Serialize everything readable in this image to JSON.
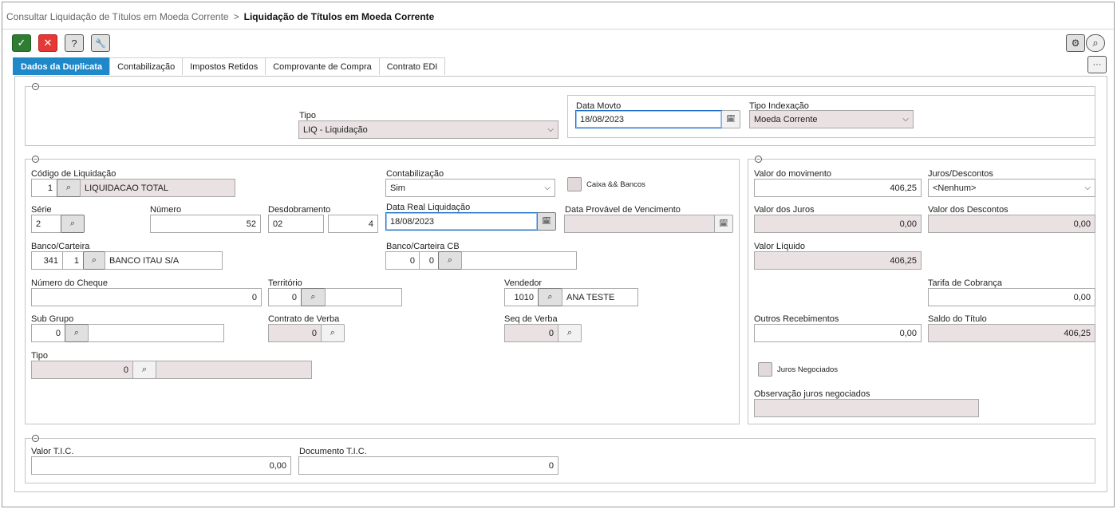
{
  "breadcrumb": {
    "parent": "Consultar Liquidação de Títulos em Moeda Corrente",
    "separator": ">",
    "current": "Liquidação de Títulos em Moeda Corrente"
  },
  "toolbar": {
    "confirm": "✓",
    "cancel": "✕",
    "help": "?",
    "tools": "🔧",
    "settings": "⚙",
    "search": "⌕",
    "more": "···"
  },
  "tabs": [
    "Dados da Duplicata",
    "Contabilização",
    "Impostos Retidos",
    "Comprovante de Compra",
    "Contrato EDI"
  ],
  "icons": {
    "collapse": "−",
    "lookup": "⌕",
    "calendar": "🗓",
    "chevron": "⌵"
  },
  "top": {
    "tipo_label": "Tipo",
    "tipo_value": "LIQ - Liquidação",
    "data_movto_label": "Data Movto",
    "data_movto_value": "18/08/2023",
    "tipo_indexacao_label": "Tipo Indexação",
    "tipo_indexacao_value": "Moeda Corrente"
  },
  "main": {
    "cod_liq_label": "Código de Liquidação",
    "cod_liq_value": "1",
    "cod_liq_desc": "LIQUIDACAO TOTAL",
    "contab_label": "Contabilização",
    "contab_value": "Sim",
    "caixa_label": "Caixa && Bancos",
    "serie_label": "Série",
    "serie_value": "2",
    "numero_label": "Número",
    "numero_value": "52",
    "desdob_label": "Desdobramento",
    "desdob_value1": "02",
    "desdob_value2": "4",
    "data_real_label": "Data Real Liquidação",
    "data_real_value": "18/08/2023",
    "data_prov_label": "Data Provável de Vencimento",
    "banco_label": "Banco/Carteira",
    "banco_value1": "341",
    "banco_value2": "1",
    "banco_desc": "BANCO ITAU S/A",
    "banco_cb_label": "Banco/Carteira CB",
    "banco_cb_value1": "0",
    "banco_cb_value2": "0",
    "cheque_label": "Número do Cheque",
    "cheque_value": "0",
    "territorio_label": "Território",
    "territorio_value": "0",
    "vendedor_label": "Vendedor",
    "vendedor_value": "1010",
    "vendedor_desc": "ANA TESTE",
    "subgrupo_label": "Sub Grupo",
    "subgrupo_value": "0",
    "contrato_label": "Contrato de Verba",
    "contrato_value": "0",
    "seq_label": "Seq de Verba",
    "seq_value": "0",
    "tipo2_label": "Tipo",
    "tipo2_value": "0"
  },
  "right": {
    "valor_mov_label": "Valor do movimento",
    "valor_mov_value": "406,25",
    "juros_desc_label": "Juros/Descontos",
    "juros_desc_value": "<Nenhum>",
    "valor_juros_label": "Valor dos Juros",
    "valor_juros_value": "0,00",
    "valor_desc_label": "Valor dos Descontos",
    "valor_desc_value": "0,00",
    "valor_liq_label": "Valor Líquido",
    "valor_liq_value": "406,25",
    "tarifa_label": "Tarifa de Cobrança",
    "tarifa_value": "0,00",
    "outros_label": "Outros Recebimentos",
    "outros_value": "0,00",
    "saldo_label": "Saldo do Título",
    "saldo_value": "406,25",
    "juros_neg_label": "Juros Negociados",
    "obs_label": "Observação juros negociados"
  },
  "bottom": {
    "valor_tic_label": "Valor T.I.C.",
    "valor_tic_value": "0,00",
    "doc_tic_label": "Documento T.I.C.",
    "doc_tic_value": "0"
  }
}
